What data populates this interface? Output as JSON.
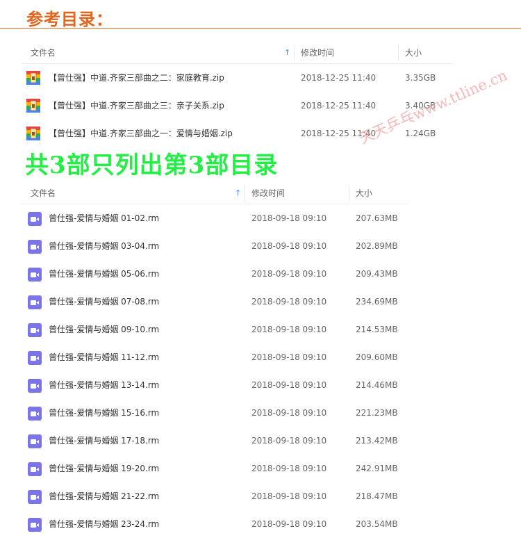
{
  "page": {
    "title": "参考目录："
  },
  "table1": {
    "headers": {
      "name": "文件名",
      "modified": "修改时间",
      "size": "大小"
    },
    "sort_icon": "arrow-up-icon",
    "rows": [
      {
        "name": "【曾仕强】中道.齐家三部曲之二：家庭教育.zip",
        "modified": "2018-12-25 11:40",
        "size": "3.35GB",
        "icon": "zip-archive-icon"
      },
      {
        "name": "【曾仕强】中道.齐家三部曲之三：亲子关系.zip",
        "modified": "2018-12-25 11:40",
        "size": "3.40GB",
        "icon": "zip-archive-icon"
      },
      {
        "name": "【曾仕强】中道.齐家三部曲之一：爱情与婚姻.zip",
        "modified": "2018-12-25 11:40",
        "size": "1.24GB",
        "icon": "zip-archive-icon"
      }
    ]
  },
  "overlay_text": "共3部只列出第3部目录",
  "watermark": "天天乒乓www.ttline.cn",
  "table2": {
    "headers": {
      "name": "文件名",
      "modified": "修改时间",
      "size": "大小"
    },
    "sort_icon": "arrow-up-icon",
    "rows": [
      {
        "name": "曾仕强-爱情与婚姻 01-02.rm",
        "modified": "2018-09-18 09:10",
        "size": "207.63MB",
        "icon": "video-file-icon"
      },
      {
        "name": "曾仕强-爱情与婚姻 03-04.rm",
        "modified": "2018-09-18 09:10",
        "size": "202.89MB",
        "icon": "video-file-icon"
      },
      {
        "name": "曾仕强-爱情与婚姻 05-06.rm",
        "modified": "2018-09-18 09:10",
        "size": "209.43MB",
        "icon": "video-file-icon"
      },
      {
        "name": "曾仕强-爱情与婚姻 07-08.rm",
        "modified": "2018-09-18 09:10",
        "size": "234.69MB",
        "icon": "video-file-icon"
      },
      {
        "name": "曾仕强-爱情与婚姻 09-10.rm",
        "modified": "2018-09-18 09:10",
        "size": "214.53MB",
        "icon": "video-file-icon"
      },
      {
        "name": "曾仕强-爱情与婚姻 11-12.rm",
        "modified": "2018-09-18 09:10",
        "size": "209.60MB",
        "icon": "video-file-icon"
      },
      {
        "name": "曾仕强-爱情与婚姻 13-14.rm",
        "modified": "2018-09-18 09:10",
        "size": "214.46MB",
        "icon": "video-file-icon"
      },
      {
        "name": "曾仕强-爱情与婚姻 15-16.rm",
        "modified": "2018-09-18 09:10",
        "size": "221.23MB",
        "icon": "video-file-icon"
      },
      {
        "name": "曾仕强-爱情与婚姻 17-18.rm",
        "modified": "2018-09-18 09:10",
        "size": "213.42MB",
        "icon": "video-file-icon"
      },
      {
        "name": "曾仕强-爱情与婚姻 19-20.rm",
        "modified": "2018-09-18 09:10",
        "size": "242.91MB",
        "icon": "video-file-icon"
      },
      {
        "name": "曾仕强-爱情与婚姻 21-22.rm",
        "modified": "2018-09-18 09:10",
        "size": "218.47MB",
        "icon": "video-file-icon"
      },
      {
        "name": "曾仕强-爱情与婚姻 23-24.rm",
        "modified": "2018-09-18 09:10",
        "size": "203.54MB",
        "icon": "video-file-icon"
      }
    ]
  },
  "colors": {
    "title": "#e0641c",
    "overlay": "#22ee44",
    "watermark": "#f6a0a0",
    "sort_arrow": "#3b8cff",
    "video_icon": "#7b74e8"
  }
}
